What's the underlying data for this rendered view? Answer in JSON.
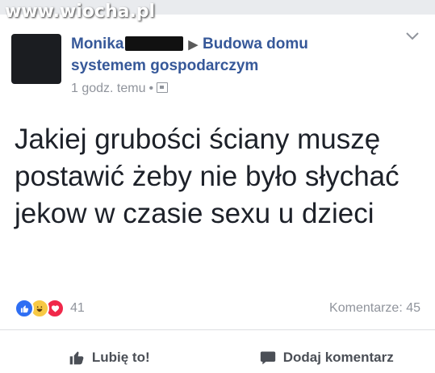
{
  "watermark": "www.wiocha.pl",
  "post": {
    "author": "Monika",
    "group": "Budowa domu systemem gospodarczym",
    "time": "1 godz. temu",
    "text": "Jakiej grubości ściany muszę postawić żeby nie było słychać jekow w czasie sexu u dzieci",
    "reaction_count": "41",
    "comments": "Komentarze: 45"
  },
  "icons": {
    "more": "chevron-down-icon",
    "privacy": "group-icon",
    "like": "thumbs-up-icon",
    "comment": "speech-bubble-icon"
  },
  "actions": {
    "like_label": "Lubię to!",
    "comment_label": "Dodaj komentarz"
  },
  "colors": {
    "link": "#365899",
    "like_reaction": "#2e6ef3",
    "haha_reaction": "#f7c945",
    "love_reaction": "#f0284a"
  }
}
